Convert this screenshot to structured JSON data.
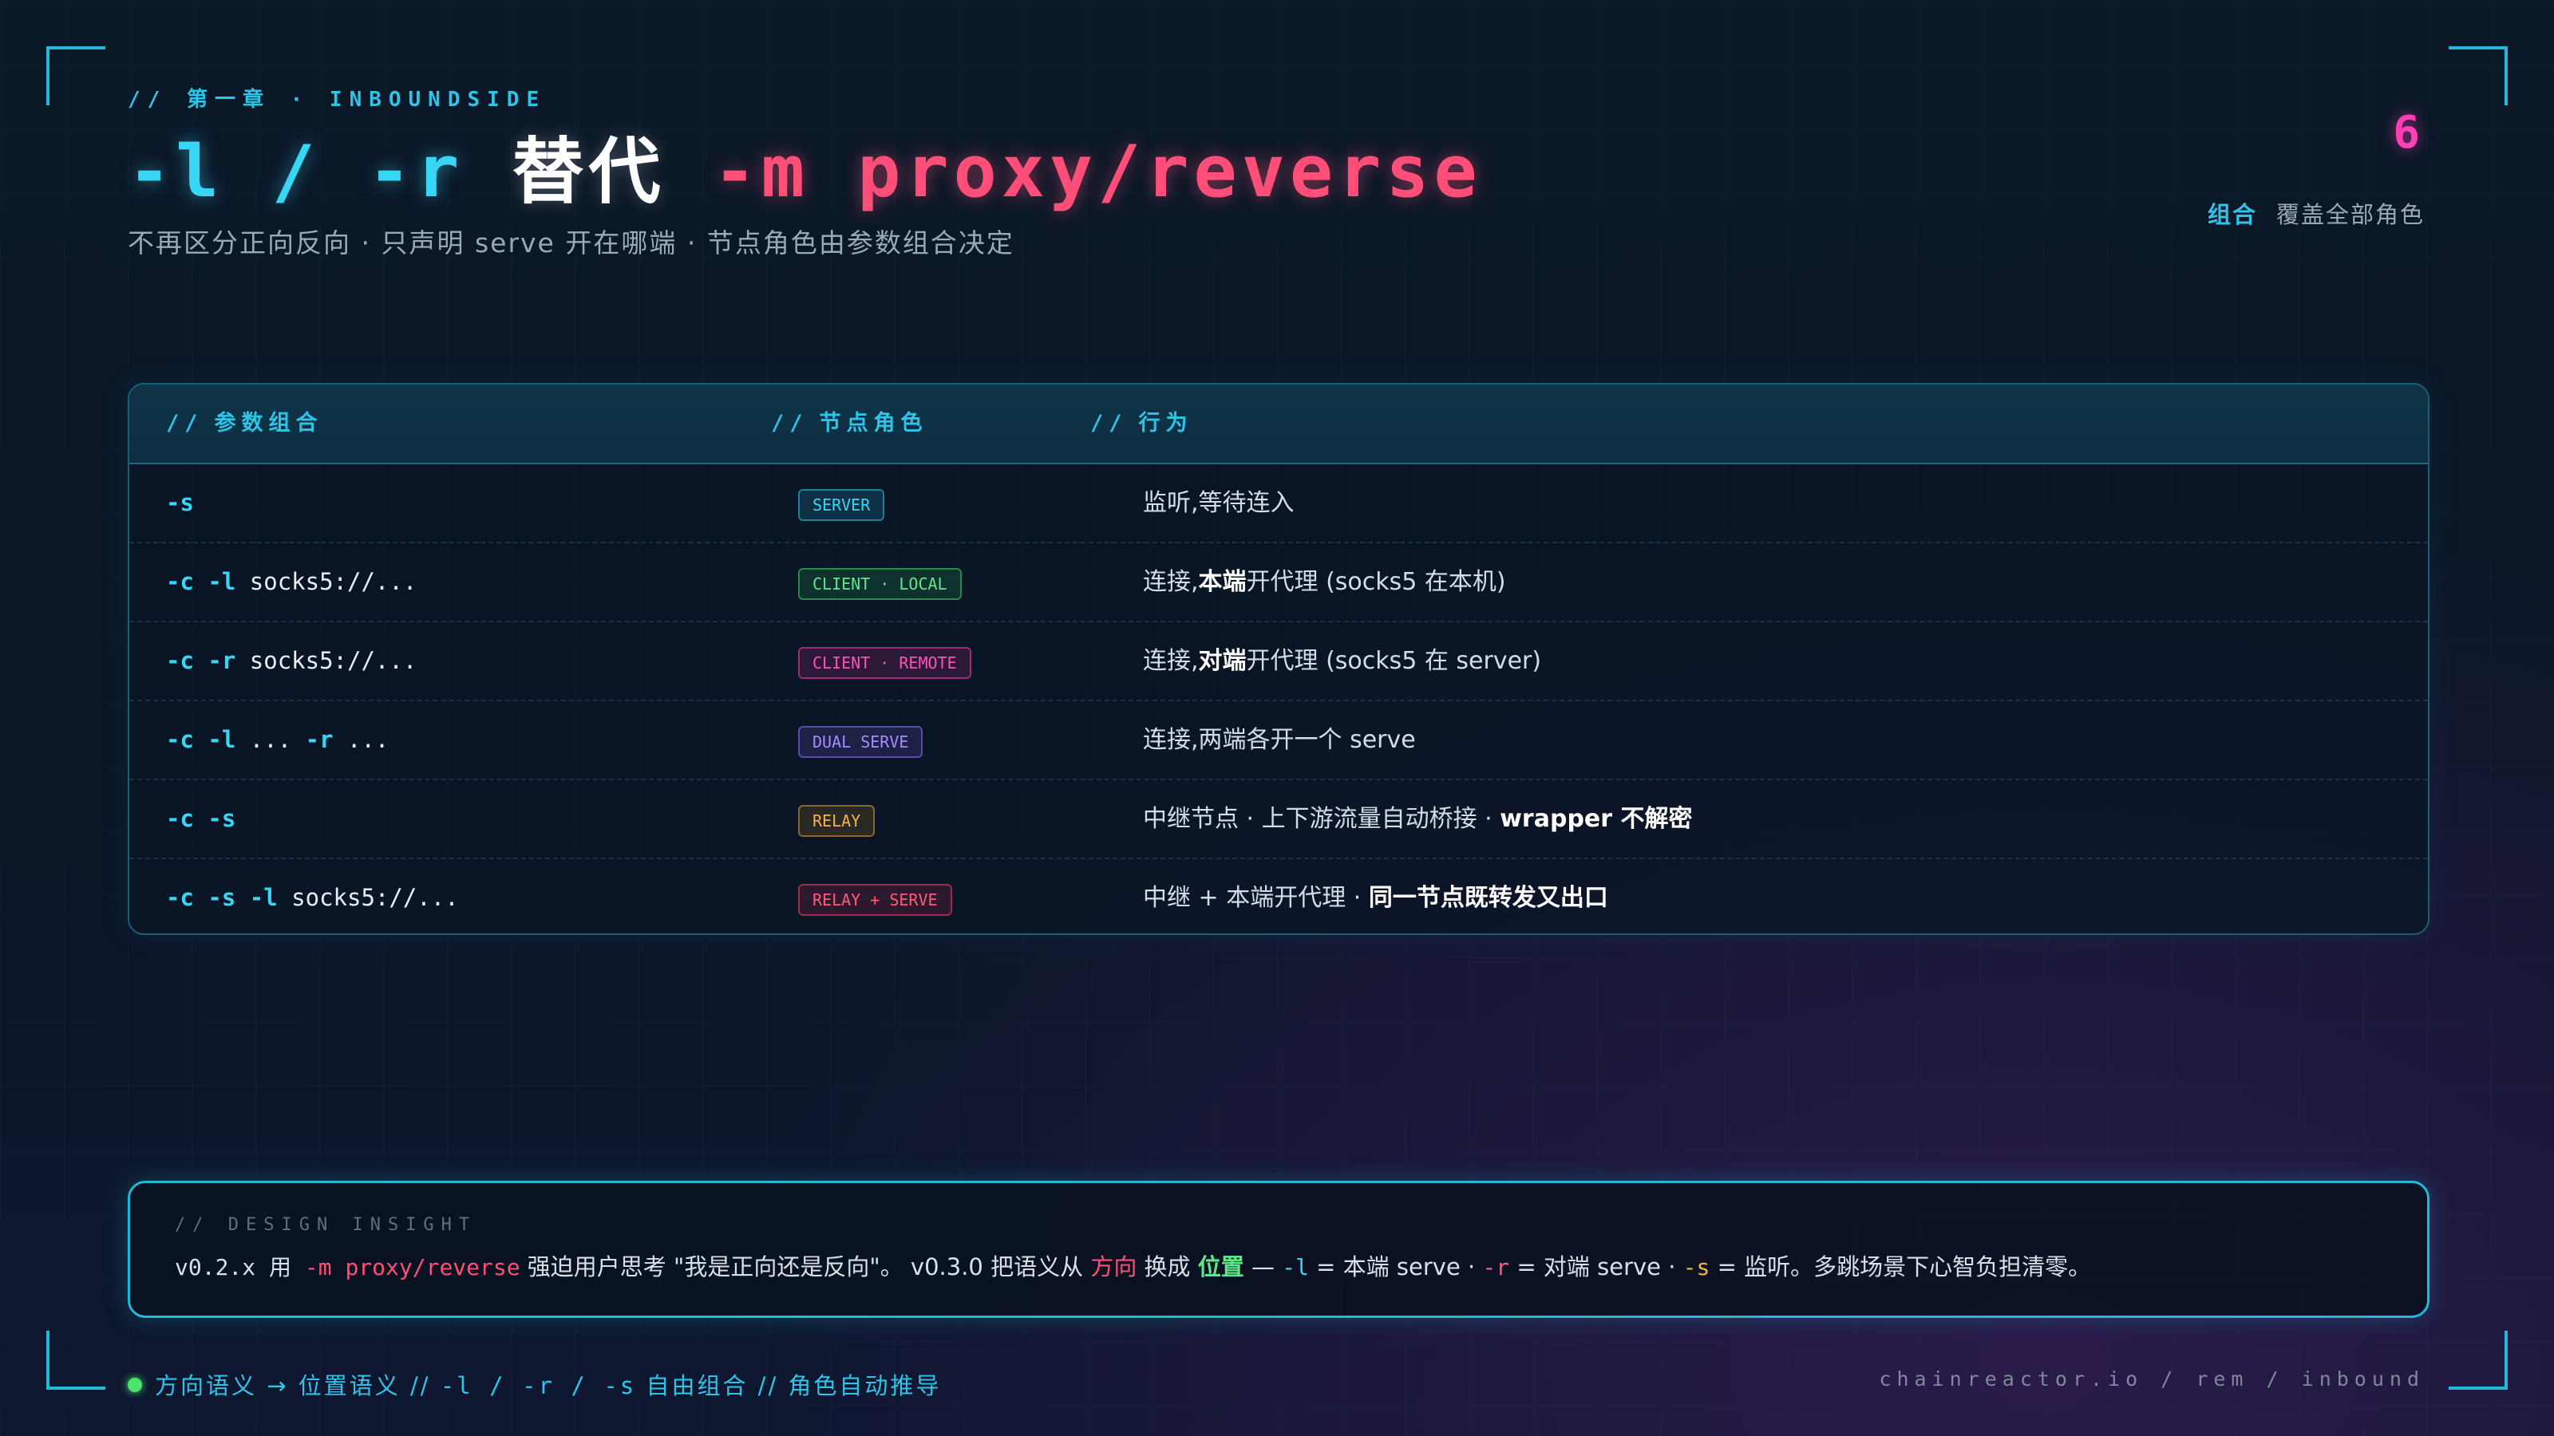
{
  "header": {
    "chapter": "// 第一章 · INBOUNDSIDE",
    "title": {
      "part1": "-l / -r ",
      "part2": "替代",
      "part3": " -m proxy/reverse"
    },
    "subtitle": "不再区分正向反向 · 只声明 serve 开在哪端 · 节点角色由参数组合决定",
    "page_number": "6",
    "tag_key": "组合",
    "tag_value": "覆盖全部角色"
  },
  "table": {
    "headers": {
      "prefix": "//",
      "col1": "参数组合",
      "col2": "节点角色",
      "col3": "行为"
    },
    "rows": [
      {
        "cmd": [
          {
            "t": "-s",
            "f": true
          }
        ],
        "badge": "SERVER",
        "behavior": [
          {
            "t": "监听,等待连入"
          }
        ]
      },
      {
        "cmd": [
          {
            "t": "-c",
            "f": true
          },
          {
            "t": " "
          },
          {
            "t": "-l",
            "f": true
          },
          {
            "t": " socks5://..."
          }
        ],
        "badge": "CLIENT · LOCAL",
        "behavior": [
          {
            "t": "连接,"
          },
          {
            "t": "本端",
            "b": true
          },
          {
            "t": "开代理 (socks5 在本机)"
          }
        ]
      },
      {
        "cmd": [
          {
            "t": "-c",
            "f": true
          },
          {
            "t": " "
          },
          {
            "t": "-r",
            "f": true
          },
          {
            "t": " socks5://..."
          }
        ],
        "badge": "CLIENT · REMOTE",
        "behavior": [
          {
            "t": "连接,"
          },
          {
            "t": "对端",
            "b": true
          },
          {
            "t": "开代理 (socks5 在 server)"
          }
        ]
      },
      {
        "cmd": [
          {
            "t": "-c",
            "f": true
          },
          {
            "t": " "
          },
          {
            "t": "-l",
            "f": true
          },
          {
            "t": " ... "
          },
          {
            "t": "-r",
            "f": true
          },
          {
            "t": " ..."
          }
        ],
        "badge": "DUAL SERVE",
        "behavior": [
          {
            "t": "连接,两端各开一个 serve"
          }
        ]
      },
      {
        "cmd": [
          {
            "t": "-c",
            "f": true
          },
          {
            "t": " "
          },
          {
            "t": "-s",
            "f": true
          }
        ],
        "badge": "RELAY",
        "behavior": [
          {
            "t": "中继节点 · 上下游流量自动桥接 · "
          },
          {
            "t": "wrapper 不解密",
            "b": true
          }
        ]
      },
      {
        "cmd": [
          {
            "t": "-c",
            "f": true
          },
          {
            "t": " "
          },
          {
            "t": "-s",
            "f": true
          },
          {
            "t": " "
          },
          {
            "t": "-l",
            "f": true
          },
          {
            "t": " socks5://..."
          }
        ],
        "badge": "RELAY + SERVE",
        "behavior": [
          {
            "t": "中继 + 本端开代理 · "
          },
          {
            "t": "同一节点既转发又出口",
            "b": true
          }
        ]
      }
    ]
  },
  "insight": {
    "label": "// DESIGN INSIGHT",
    "segments": [
      {
        "t": "v0.2.x 用 ",
        "c": ""
      },
      {
        "t": "-m proxy/reverse",
        "c": "pk"
      },
      {
        "t": " 强迫用户思考 \"我是正向还是反向\"。 v0.3.0 把语义从 ",
        "c": ""
      },
      {
        "t": "方向",
        "c": "pk"
      },
      {
        "t": " 换成 ",
        "c": ""
      },
      {
        "t": "位置",
        "c": "gr"
      },
      {
        "t": " — ",
        "c": ""
      },
      {
        "t": "-l",
        "c": "cy"
      },
      {
        "t": " = 本端 serve · ",
        "c": ""
      },
      {
        "t": "-r",
        "c": "pkc"
      },
      {
        "t": " = 对端 serve · ",
        "c": ""
      },
      {
        "t": "-s",
        "c": "or"
      },
      {
        "t": " = 监听。多跳场景下心智负担清零。",
        "c": ""
      }
    ]
  },
  "footer": {
    "left_a": "方向语义 → 位置语义 // ",
    "left_b": "-l / -r / -s",
    "left_c": " 自由组合 // 角色自动推导",
    "right": "chainreactor.io / rem / inbound"
  },
  "colors": {
    "accent_cyan": "#2ec4e8",
    "accent_pink": "#ff4f79",
    "page_number": "#ff3fb4",
    "status_dot": "#4be46a"
  },
  "icons": {
    "status": "status-dot-icon",
    "corners": "corner-bracket-icon"
  }
}
